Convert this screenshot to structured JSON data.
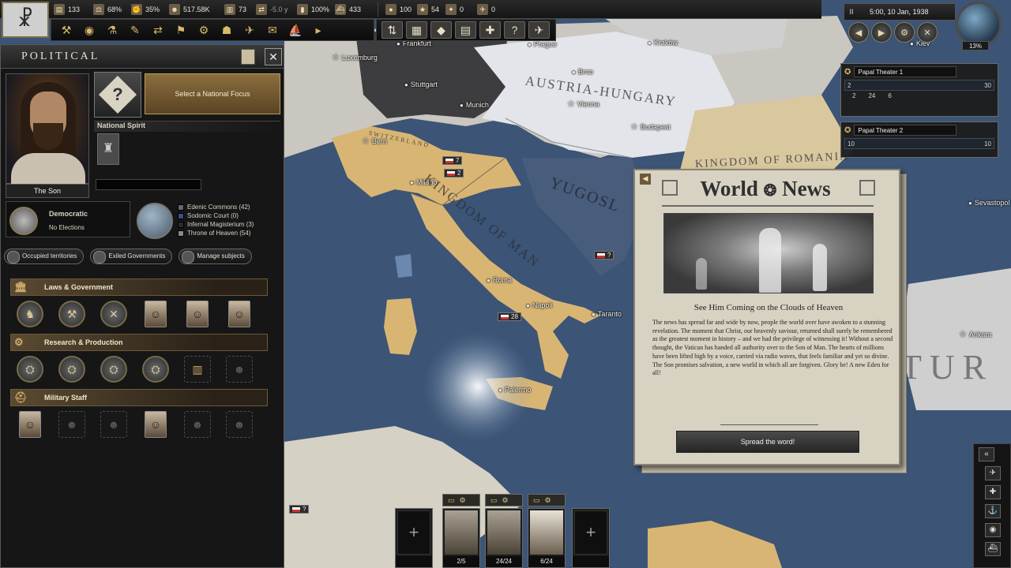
{
  "topbar": {
    "resources": [
      {
        "icon": "factory-icon",
        "glyph": "▤",
        "value": "133"
      },
      {
        "icon": "scales-icon",
        "glyph": "⚖",
        "value": "68%"
      },
      {
        "icon": "war-support-icon",
        "glyph": "✊",
        "value": "35%"
      },
      {
        "icon": "manpower-icon",
        "glyph": "☻",
        "value": "517.58K"
      },
      {
        "icon": "civilian-factory-icon",
        "glyph": "▥",
        "value": "73"
      },
      {
        "icon": "lend-lease-icon",
        "glyph": "⇄",
        "value": "-5.0 y"
      },
      {
        "icon": "stability-icon",
        "glyph": "▮",
        "value": "100%"
      },
      {
        "icon": "convoy-icon",
        "glyph": "⛴",
        "value": "433"
      },
      {
        "icon": "oil-icon",
        "glyph": "●",
        "value": "100"
      },
      {
        "icon": "army-exp-icon",
        "glyph": "★",
        "value": "54"
      },
      {
        "icon": "navy-exp-icon",
        "glyph": "✦",
        "value": "0"
      },
      {
        "icon": "air-exp-icon",
        "glyph": "✈",
        "value": "0"
      }
    ]
  },
  "flag": {
    "glyph": "☧"
  },
  "date": {
    "text": "5:00, 10 Jan, 1938",
    "pause": "II"
  },
  "globe": {
    "percent": "13%"
  },
  "speed_buttons": [
    "◀",
    "▶",
    "⚙",
    "✕"
  ],
  "theaters": [
    {
      "name": "Papal Theater 1",
      "left": "2",
      "right": "30",
      "units": [
        "2",
        "24",
        "6"
      ]
    },
    {
      "name": "Papal Theater 2",
      "left": "10",
      "right": "10"
    }
  ],
  "map": {
    "cities": [
      {
        "name": "Luxemburg",
        "capital": true
      },
      {
        "name": "Frankfurt",
        "capital": false
      },
      {
        "name": "Stuttgart",
        "capital": false
      },
      {
        "name": "Munich",
        "capital": false
      },
      {
        "name": "Prague",
        "capital": false
      },
      {
        "name": "Brno",
        "capital": false
      },
      {
        "name": "Vienna",
        "capital": true
      },
      {
        "name": "Kraków",
        "capital": false
      },
      {
        "name": "Budapest",
        "capital": true
      },
      {
        "name": "Bern",
        "capital": true
      },
      {
        "name": "Milano",
        "capital": false
      },
      {
        "name": "Roma",
        "capital": false
      },
      {
        "name": "Napoli",
        "capital": false
      },
      {
        "name": "Taranto",
        "capital": false
      },
      {
        "name": "Palermo",
        "capital": false
      },
      {
        "name": "Ankara",
        "capital": true
      },
      {
        "name": "Sevastopol",
        "capital": false
      },
      {
        "name": "Kiev",
        "capital": false
      }
    ],
    "countries": [
      {
        "name": "AUSTRIA-HUNGARY"
      },
      {
        "name": "KINGDOM OF MAN"
      },
      {
        "name": "KINGDOM OF ROMANIA"
      },
      {
        "name": "YUGOSL"
      },
      {
        "name": "SWITZERLAND"
      },
      {
        "name": "TUR"
      }
    ],
    "unit_chips": [
      "7",
      "2",
      "?",
      "28",
      "?"
    ]
  },
  "political": {
    "title": "POLITICAL",
    "leader_name": "The Son",
    "focus_label": "Select a National Focus",
    "national_spirit": "National Spirit",
    "government": "Democratic",
    "elections": "No Elections",
    "parties": [
      {
        "name": "Edenic Commons (42)",
        "color": "#5a6a7a"
      },
      {
        "name": "Sodomic Court (0)",
        "color": "#3b4f8a"
      },
      {
        "name": "Infernal Magisterium (3)",
        "color": "#2b2b2b"
      },
      {
        "name": "Throne of Heaven (54)",
        "color": "#8a8a8a"
      }
    ],
    "subject_buttons": [
      "Occupied territories",
      "Exiled Governments",
      "Manage subjects"
    ],
    "categories": [
      {
        "title": "Laws & Government",
        "icon": "columns-icon",
        "glyph": "🏛"
      },
      {
        "title": "Research & Production",
        "icon": "gears-icon",
        "glyph": "⚙"
      },
      {
        "title": "Military Staff",
        "icon": "helmet-icon",
        "glyph": "⛑"
      }
    ]
  },
  "news": {
    "title": "World",
    "title2": "News",
    "headline": "See Him Coming on the Clouds of Heaven",
    "body": "The news has spread far and wide by now, people the world over have awoken to a stunning revelation. The moment that Christ, our heavenly saviour, returned shall surely be remembered as the greatest moment in history – and we had the privilege of witnessing it! Without a second thought, the Vatican has handed all authority over to the Son of Man. The hearts of millions have been lifted high by a voice, carried via radio waves, that feels familiar and yet so divine. The Son promises salvation, a new world in which all are forgiven. Glory be! A new Eden for all!",
    "button": "Spread the word!"
  },
  "army": {
    "cards": [
      {
        "count": ""
      },
      {
        "count": "2/5"
      },
      {
        "count": "24/24"
      },
      {
        "count": "6/24"
      },
      {
        "count": ""
      }
    ]
  }
}
